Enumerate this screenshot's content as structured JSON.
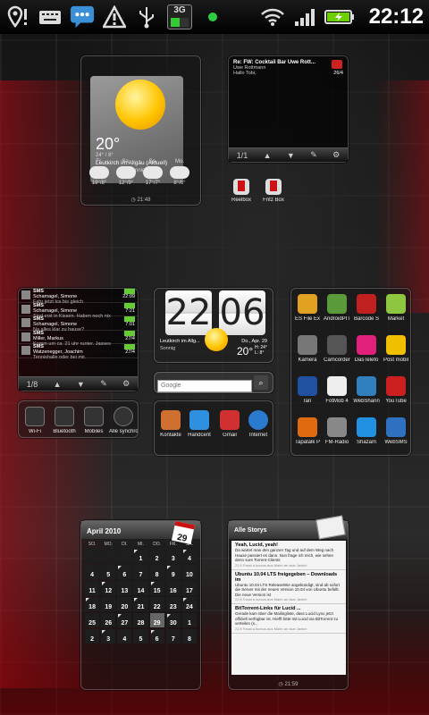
{
  "statusbar": {
    "time": "22:12",
    "network": "3G"
  },
  "weather": {
    "temp": "20°",
    "range": "24° / 8°",
    "location": "Leutkirch im Allgäu (Aktuell)",
    "condition": "Sonnig",
    "forecast": [
      {
        "day": "Fr.",
        "temps": "19°/8°"
      },
      {
        "day": "Sa.",
        "temps": "12°/9°"
      },
      {
        "day": "So.",
        "temps": "17°/7°"
      },
      {
        "day": "Mo.",
        "temps": "8°/6°"
      }
    ],
    "updated": "21:48"
  },
  "mail": {
    "subject": "Re: FW: Cocktail Bar Uwe Rott...",
    "from": "Uwe Rottmann",
    "preview": "Hallo Tobi,",
    "date": "26/4",
    "page": "1/1"
  },
  "shortcuts_top": [
    {
      "label": "Reelbox"
    },
    {
      "label": "Fritz Box"
    }
  ],
  "sms": {
    "page": "1/8",
    "items": [
      {
        "title": "SMS",
        "name": "Schamagel, Simone",
        "text": "Fahr jetzt los bis gleich",
        "time": "22:09"
      },
      {
        "title": "SMS",
        "name": "Schamagel, Simone",
        "text": "Sind erst in Kissen. Haben noch nix",
        "time": "7:21"
      },
      {
        "title": "SMS",
        "name": "Schamagel, Simone",
        "text": "Na alles klar zu hause?",
        "time": "7:01"
      },
      {
        "title": "SMS",
        "name": "Miller, Markus",
        "text": "Komm um ca. 21 uhr runter. Jasses",
        "time": "27/4"
      },
      {
        "title": "SMS",
        "name": "Watzenegger, Joachim",
        "text": "Tennishalle oder bei mir.",
        "time": "27/4"
      }
    ]
  },
  "clock": {
    "hour": "22",
    "minute": "06",
    "location": "Leutkirch im Allg...",
    "condition": "Sonnig",
    "date": "Do., Apr. 29",
    "temp": "20°",
    "hilo": "H: 24°\nL: 8°"
  },
  "search": {
    "placeholder": "Google"
  },
  "app_grid": [
    {
      "label": "ES File Ex",
      "color": "#e0a020"
    },
    {
      "label": "AndroidPIT",
      "color": "#5a9a3a"
    },
    {
      "label": "Barcode S",
      "color": "#c02020"
    },
    {
      "label": "Market",
      "color": "#8ec63f"
    },
    {
      "label": "Kamera",
      "color": "#777777"
    },
    {
      "label": "Camcorder",
      "color": "#555555"
    },
    {
      "label": "DasTelefo",
      "color": "#e0207a"
    },
    {
      "label": "Post mobil",
      "color": "#f0c000"
    },
    {
      "label": "ran",
      "color": "#2050a0"
    },
    {
      "label": "FotMob 4",
      "color": "#eeeeee"
    },
    {
      "label": "WebSharin",
      "color": "#3080c0"
    },
    {
      "label": "YouTube",
      "color": "#cc2020"
    },
    {
      "label": "Tapatalk P",
      "color": "#e06a10"
    },
    {
      "label": "FM-Radio",
      "color": "#888888"
    },
    {
      "label": "Shazam",
      "color": "#2090e0"
    },
    {
      "label": "WebSMS",
      "color": "#3070c0"
    }
  ],
  "dock_apps": [
    {
      "label": "Kontakte",
      "color": "#d07030"
    },
    {
      "label": "Handcent",
      "color": "#3090e0"
    },
    {
      "label": "Gmail",
      "color": "#d03030"
    },
    {
      "label": "Internet",
      "color": "#2a7ad0"
    }
  ],
  "toggles": [
    {
      "label": "Wi-Fi"
    },
    {
      "label": "Bluetooth"
    },
    {
      "label": "Mobiles"
    },
    {
      "label": "Alle synchro"
    }
  ],
  "calendar": {
    "title": "April 2010",
    "badge_day": "29",
    "weekdays": [
      "SO.",
      "MO.",
      "DI.",
      "MI.",
      "DO.",
      "FR.",
      "SA."
    ],
    "days": [
      "",
      "",
      "",
      "1",
      "2",
      "3",
      "4",
      "4",
      "5",
      "6",
      "7",
      "8",
      "9",
      "10",
      "11",
      "12",
      "13",
      "14",
      "15",
      "16",
      "17",
      "18",
      "19",
      "20",
      "21",
      "22",
      "23",
      "24",
      "25",
      "26",
      "27",
      "28",
      "29",
      "30",
      "1",
      "2",
      "3",
      "4",
      "5",
      "6",
      "7",
      "8"
    ]
  },
  "news": {
    "title": "Alle Storys",
    "items": [
      {
        "head": "Yeah, Lucid, yeah!",
        "body": "Da wartet man den ganzen Tag und auf dem Weg nach Hause passiert es dann. Nun frage ich mich, wie sehen denn sure Torrent-Clients",
        "meta": "21:5 Fasst a kursus.aus Marin an xkar Jaxtch"
      },
      {
        "head": "Ubuntu 10.04 LTS freigegeben – Downloads im",
        "body": "Ubuntu 10.04 LTS ReleaseWie angekündigt, sind ab sofort die Server mit der neuen Version 10.04 von Ubuntu befüllt. Die neue Version ist",
        "meta": "21:5 Fasst a kursus.aus Marin an xkar Jaxtch"
      },
      {
        "head": "BitTorrent-Links für Lucid ...",
        "body": "Gerade kam über die Mailingliste, dass Lucid Lynx jetzt offiziell verfügbar ist. Hiefft bitte mit Lucid via BitTorrent zu verteilen (s...",
        "meta": "21:5 Fasst a kursus.aus Marin an xkar Jaxtch"
      }
    ],
    "updated": "21:59"
  }
}
